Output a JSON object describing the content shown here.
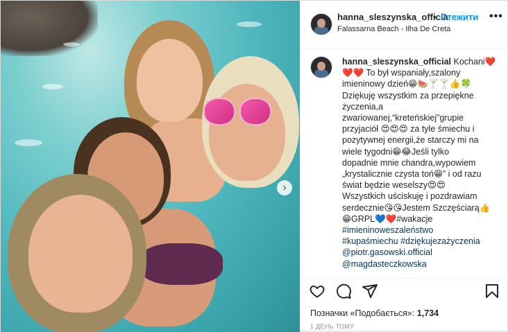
{
  "post": {
    "username": "hanna_sleszynska_officia",
    "dot": "•",
    "follow_label": "Стежити",
    "location": "Falassarna Beach - Ilha De Creta",
    "more_icon": "more-horizontal-icon"
  },
  "caption": {
    "username": "hanna_sleszynska_official",
    "lines": [
      "Kochani❤️",
      "❤️❤️ To był wspaniały,szalony",
      "imieninowy dzień😁🍉🍸🍸👍🍀",
      "Dziękuję wszystkim za przepiękne",
      "życzenia,a",
      "zwariowanej,“kreteńskiej”grupie",
      "przyjaciół 😍😍😍 za tyle śmiechu i",
      "pozytywnej energii,że starczy mi na",
      "wiele tygodni😁😂Jeśli tylko",
      "dopadnie mnie chandra,wypowiem",
      "„krystalicznie czysta toń😁” i od razu",
      "świat będzie weselszy😍😍",
      "Wszystkich uściskuję i pozdrawiam",
      "serdecznie😘😘Jestem Szczęściarą👍",
      "😁GRPL💙❤️#wakacje"
    ],
    "tags": [
      "#imieninoweszaleństwo",
      "#kupaśmiechu #dziękujezażyczenia",
      "@piotr.gasowski.official",
      "@magdasteczkowska"
    ]
  },
  "actions": {
    "like_icon": "heart-icon",
    "comment_icon": "comment-icon",
    "share_icon": "share-icon",
    "save_icon": "bookmark-icon"
  },
  "likes_text": "Позначки «Подобається»: 1,734",
  "likes_prefix": "Позначки «Подобається»: ",
  "likes_count": "1,734",
  "time_ago": "1 ДЕНЬ ТОМУ",
  "photo": {
    "next_icon": "chevron-right-icon",
    "next_glyph": "›"
  }
}
